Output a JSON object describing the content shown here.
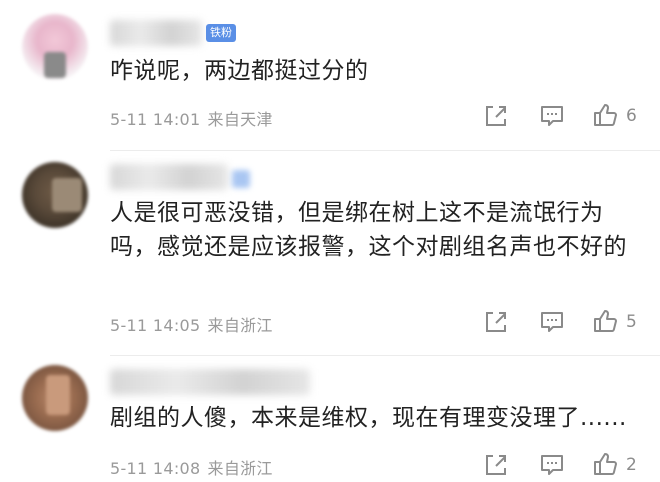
{
  "comments": [
    {
      "badge": "铁粉",
      "text": "咋说呢，两边都挺过分的",
      "time": "5-11 14:01",
      "location": "来自天津",
      "likes": "6"
    },
    {
      "text": "人是很可恶没错，但是绑在树上这不是流氓行为吗，感觉还是应该报警，这个对剧组名声也不好的",
      "time": "5-11 14:05",
      "location": "来自浙江",
      "likes": "5"
    },
    {
      "text": "剧组的人傻，本来是维权，现在有理变没理了......",
      "time": "5-11 14:08",
      "location": "来自浙江",
      "likes": "2"
    }
  ],
  "icons": {
    "share": "share-icon",
    "reply": "comment-icon",
    "like": "thumbs-up-icon"
  },
  "colors": {
    "badge": "#5a8fe6",
    "meta_text": "#9a9a9a",
    "comment_text": "#222222"
  }
}
